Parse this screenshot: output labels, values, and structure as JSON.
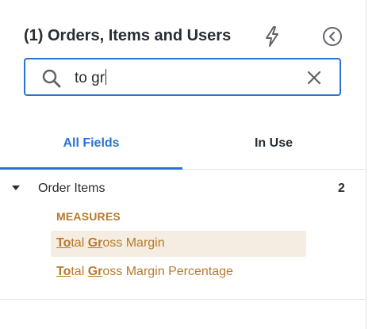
{
  "header": {
    "title": "(1) Orders, Items and Users",
    "bolt_icon": "bolt-icon",
    "collapse_icon": "chevron-left-circle-icon"
  },
  "search": {
    "value": "to gr",
    "search_icon": "search-icon",
    "clear_icon": "close-icon"
  },
  "tabs": [
    {
      "label": "All Fields",
      "active": true
    },
    {
      "label": "In Use",
      "active": false
    }
  ],
  "group": {
    "label": "Order Items",
    "count": "2"
  },
  "section_label": "MEASURES",
  "fields": [
    {
      "match1": "To",
      "text1": "tal ",
      "match2": "Gr",
      "text2": "oss Margin",
      "selected": true
    },
    {
      "match1": "To",
      "text1": "tal ",
      "match2": "Gr",
      "text2": "oss Margin Percentage",
      "selected": false
    }
  ],
  "colors": {
    "accent": "#2a73d0",
    "measure": "#b77a2d",
    "highlight_bg": "#f5ede2"
  }
}
